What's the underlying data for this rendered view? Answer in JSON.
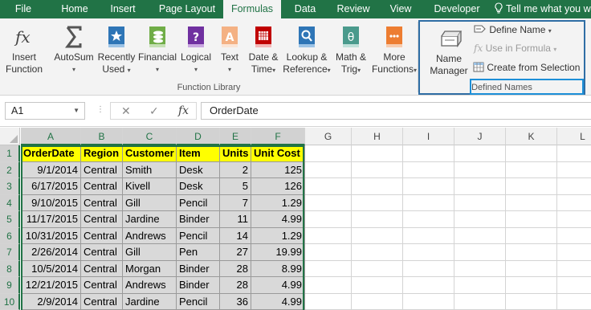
{
  "tabs": [
    {
      "label": "File",
      "active": false
    },
    {
      "label": "Home",
      "active": false
    },
    {
      "label": "Insert",
      "active": false
    },
    {
      "label": "Page Layout",
      "active": false
    },
    {
      "label": "Formulas",
      "active": true
    },
    {
      "label": "Data",
      "active": false
    },
    {
      "label": "Review",
      "active": false
    },
    {
      "label": "View",
      "active": false
    },
    {
      "label": "Developer",
      "active": false
    },
    {
      "label": "Tell me what you w",
      "active": false
    }
  ],
  "ribbon": {
    "function_library": {
      "group_label": "Function Library",
      "buttons": [
        {
          "line1": "Insert",
          "line2": "Function",
          "icon": "fx-icon"
        },
        {
          "line1": "AutoSum",
          "line2": "▾",
          "icon": "sigma-icon"
        },
        {
          "line1": "Recently",
          "line2": "Used",
          "icon": "star-book-icon"
        },
        {
          "line1": "Financial",
          "line2": "▾",
          "icon": "coins-book-icon"
        },
        {
          "line1": "Logical",
          "line2": "▾",
          "icon": "question-book-icon"
        },
        {
          "line1": "Text",
          "line2": "▾",
          "icon": "text-book-icon"
        },
        {
          "line1": "Date &",
          "line2": "Time",
          "icon": "calendar-book-icon"
        },
        {
          "line1": "Lookup &",
          "line2": "Reference",
          "icon": "search-book-icon"
        },
        {
          "line1": "Math &",
          "line2": "Trig",
          "icon": "theta-book-icon"
        },
        {
          "line1": "More",
          "line2": "Functions",
          "icon": "more-book-icon"
        }
      ]
    },
    "defined_names": {
      "group_label": "Defined Names",
      "name_manager": {
        "line1": "Name",
        "line2": "Manager"
      },
      "define_name": "Define Name",
      "use_in_formula": "Use in Formula",
      "create_from_selection": "Create from Selection"
    }
  },
  "formula_bar": {
    "name_box": "A1",
    "cancel_symbol": "✕",
    "enter_symbol": "✓",
    "fx_symbol": "fx",
    "value": "OrderDate"
  },
  "columns": [
    "A",
    "B",
    "C",
    "D",
    "E",
    "F",
    "G",
    "H",
    "I",
    "J",
    "K",
    "L"
  ],
  "rows": [
    "1",
    "2",
    "3",
    "4",
    "5",
    "6",
    "7",
    "8",
    "9",
    "10"
  ],
  "table": {
    "headers": [
      "OrderDate",
      "Region",
      "Customer",
      "Item",
      "Units",
      "Unit Cost"
    ],
    "rows": [
      [
        "9/1/2014",
        "Central",
        "Smith",
        "Desk",
        "2",
        "125"
      ],
      [
        "6/17/2015",
        "Central",
        "Kivell",
        "Desk",
        "5",
        "126"
      ],
      [
        "9/10/2015",
        "Central",
        "Gill",
        "Pencil",
        "7",
        "1.29"
      ],
      [
        "11/17/2015",
        "Central",
        "Jardine",
        "Binder",
        "11",
        "4.99"
      ],
      [
        "10/31/2015",
        "Central",
        "Andrews",
        "Pencil",
        "14",
        "1.29"
      ],
      [
        "2/26/2014",
        "Central",
        "Gill",
        "Pen",
        "27",
        "19.99"
      ],
      [
        "10/5/2014",
        "Central",
        "Morgan",
        "Binder",
        "28",
        "8.99"
      ],
      [
        "12/21/2015",
        "Central",
        "Andrews",
        "Binder",
        "28",
        "4.99"
      ],
      [
        "2/9/2014",
        "Central",
        "Jardine",
        "Pencil",
        "36",
        "4.99"
      ]
    ]
  },
  "colors": {
    "excel_green": "#217346",
    "header_yellow": "#ffff00",
    "highlight_blue": "#1d8fd8",
    "box_blue": "#2f6ea5"
  }
}
